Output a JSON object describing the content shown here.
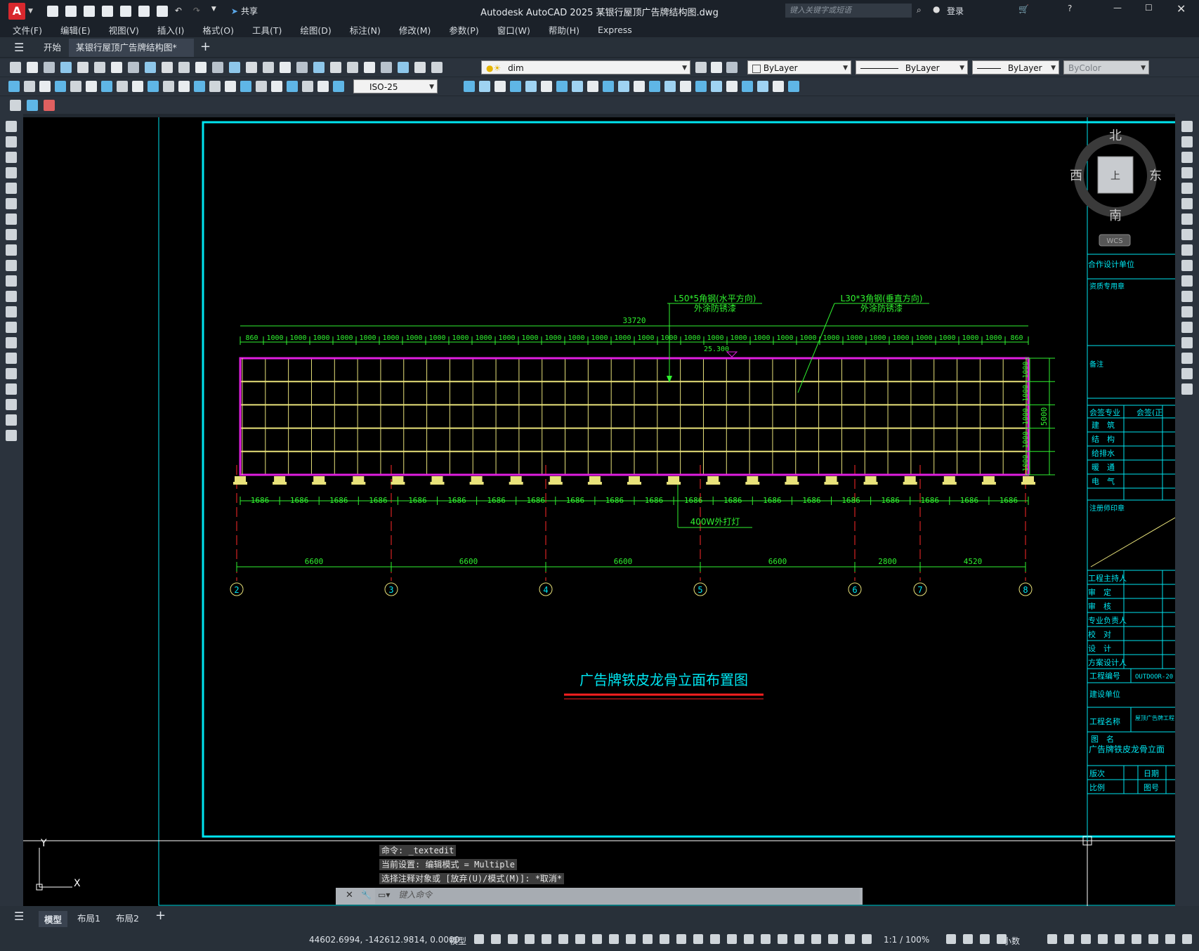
{
  "app": {
    "title": "Autodesk AutoCAD 2025    某银行屋顶广告牌结构图.dwg",
    "logo": "A",
    "share": "共享",
    "search_placeholder": "键入关键字或短语",
    "login": "登录"
  },
  "menu": [
    "文件(F)",
    "编辑(E)",
    "视图(V)",
    "插入(I)",
    "格式(O)",
    "工具(T)",
    "绘图(D)",
    "标注(N)",
    "修改(M)",
    "参数(P)",
    "窗口(W)",
    "帮助(H)",
    "Express"
  ],
  "tabs": {
    "start": "开始",
    "doc": "某银行屋顶广告牌结构图*"
  },
  "toolbar": {
    "layer": "dim",
    "color": "ByLayer",
    "linetype": "ByLayer",
    "lineweight": "ByLayer",
    "plotstyle": "ByColor",
    "dimstyle": "ISO-25"
  },
  "viewcube": {
    "north": "北",
    "south": "南",
    "east": "东",
    "west": "西",
    "face": "上",
    "wcs": "WCS"
  },
  "drawing": {
    "title": "广告牌铁皮龙骨立面布置图",
    "note_h_1": "L50*5角钢(水平方向)",
    "note_h_2": "外涂防锈漆",
    "note_v_1": "L30*3角钢(垂直方向)",
    "note_v_2": "外涂防锈漆",
    "total": "33720",
    "elev": "25.300",
    "lamp": "400W外打灯",
    "right_total": "5000",
    "top_dims": [
      "860",
      "1000",
      "1000",
      "1000",
      "1000",
      "1000",
      "1000",
      "1000",
      "1000",
      "1000",
      "1000",
      "1000",
      "1000",
      "1000",
      "1000",
      "1000",
      "1000",
      "1000",
      "1000",
      "1000",
      "1000",
      "1000",
      "1000",
      "1000",
      "1000",
      "1000",
      "1000",
      "1000",
      "1000",
      "1000",
      "1000",
      "1000",
      "1000",
      "860"
    ],
    "right_dims": [
      "1000",
      "1000",
      "1000",
      "1000",
      "1000"
    ],
    "lamp_dims": [
      "1686",
      "1686",
      "1686",
      "1686",
      "1686",
      "1686",
      "1686",
      "1686",
      "1686",
      "1686",
      "1686",
      "1686",
      "1686",
      "1686",
      "1686",
      "1686",
      "1686",
      "1686",
      "1686",
      "1686"
    ],
    "axis_dims": [
      "6600",
      "6600",
      "6600",
      "6600",
      "2800",
      "4520"
    ],
    "axes": [
      "2",
      "3",
      "4",
      "5",
      "6",
      "7",
      "8"
    ]
  },
  "titleblock": {
    "coop": "合作设计单位",
    "qual": "资质专用章",
    "remark": "备注",
    "sign_spec": "会签专业",
    "sign": "会签(正",
    "specs": [
      "建　筑",
      "结　构",
      "给排水",
      "暖　通",
      "电　气"
    ],
    "stamp": "注册师印章",
    "roles": [
      "工程主持人",
      "审　定",
      "审　核",
      "专业负责人",
      "校　对",
      "设　计",
      "方案设计人"
    ],
    "proj_no_label": "工程编号",
    "proj_no": "OUTDOOR-20",
    "owner": "建设单位",
    "proj_name_label": "工程名称",
    "proj_name": "屋顶广告牌工程",
    "drawing_name_label": "图　名",
    "drawing_name": "广告牌铁皮龙骨立面",
    "version": "版次",
    "date": "日期",
    "scale": "比例",
    "sheet": "图号"
  },
  "command": {
    "line1": "命令: _textedit",
    "line2": "当前设置: 编辑模式 = Multiple",
    "line3": "选择注释对象或 [放弃(U)/模式(M)]: *取消*",
    "placeholder": "键入命令"
  },
  "layouts": [
    "模型",
    "布局1",
    "布局2"
  ],
  "status": {
    "coords": "44602.6994, -142612.9814, 0.0000",
    "model": "模型",
    "scale": "1:1 / 100%",
    "units": "小数"
  }
}
